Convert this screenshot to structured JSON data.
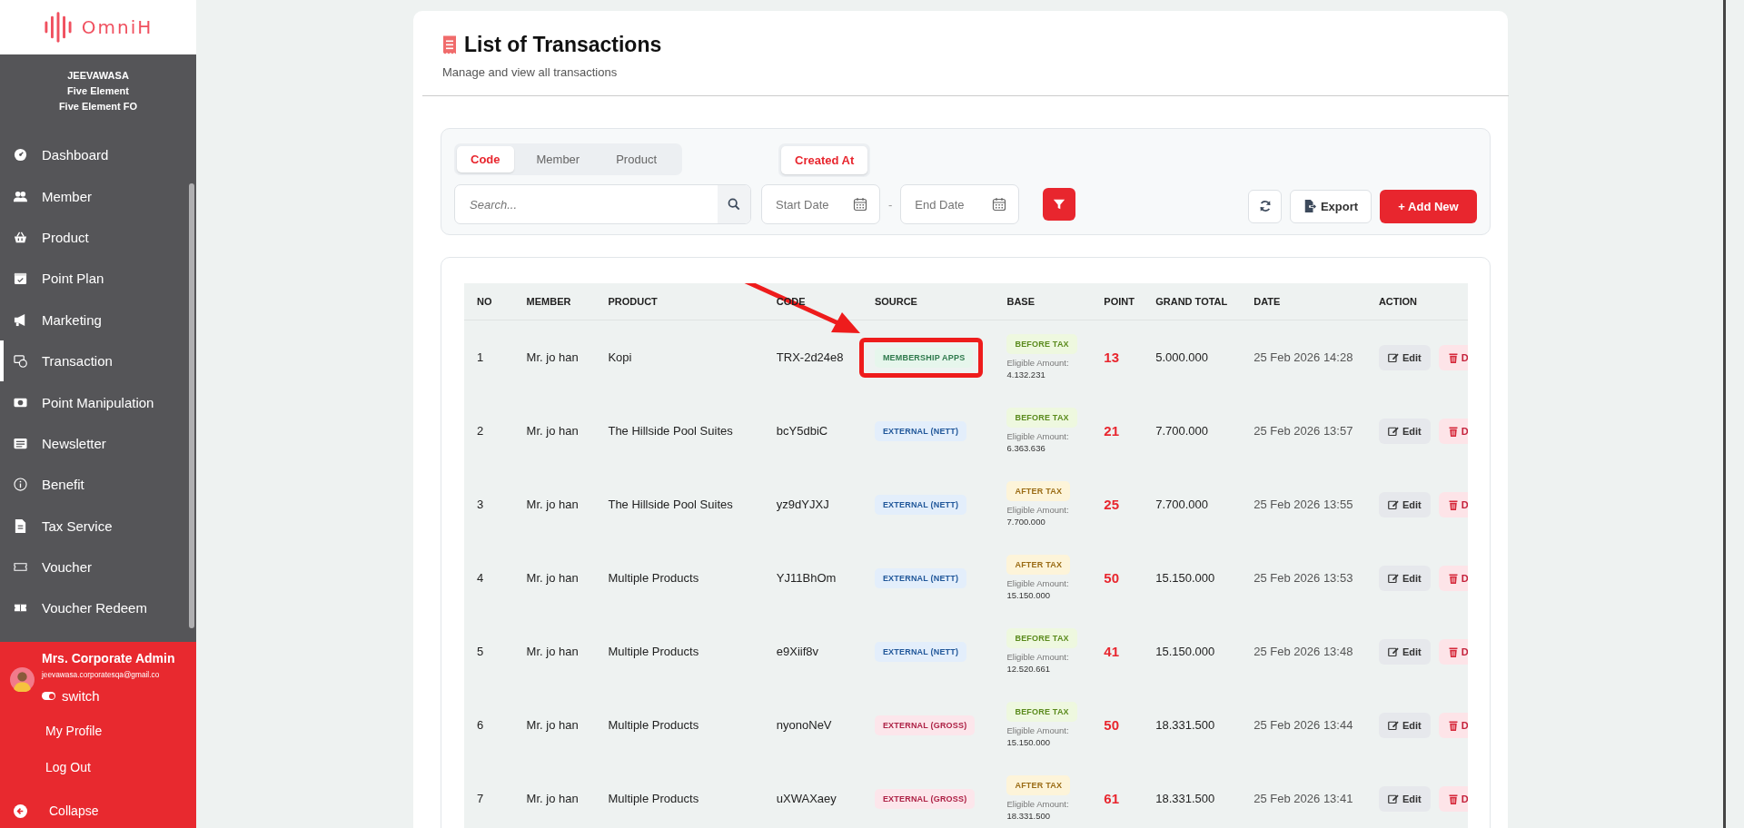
{
  "sidebar": {
    "logo": "OmniH",
    "org": [
      "JEEVAWASA",
      "Five Element",
      "Five Element FO"
    ],
    "items": [
      {
        "label": "Dashboard",
        "selected": false
      },
      {
        "label": "Member",
        "selected": false
      },
      {
        "label": "Product",
        "selected": false
      },
      {
        "label": "Point Plan",
        "selected": false
      },
      {
        "label": "Marketing",
        "selected": false
      },
      {
        "label": "Transaction",
        "selected": true
      },
      {
        "label": "Point Manipulation",
        "selected": false
      },
      {
        "label": "Newsletter",
        "selected": false
      },
      {
        "label": "Benefit",
        "selected": false
      },
      {
        "label": "Tax Service",
        "selected": false
      },
      {
        "label": "Voucher",
        "selected": false
      },
      {
        "label": "Voucher Redeem",
        "selected": false
      }
    ],
    "user": {
      "name": "Mrs. Corporate Admin",
      "email": "jeevawasa.corporatesqa@gmail.co",
      "switch": {
        "label": "switch",
        "on": true
      }
    },
    "links": [
      "My Profile",
      "Log Out"
    ],
    "collapse": "Collapse"
  },
  "header": {
    "title": "List of Transactions",
    "subtitle": "Manage and view all transactions"
  },
  "filters": {
    "search_tabs": [
      {
        "label": "Code",
        "selected": true
      },
      {
        "label": "Member",
        "selected": false
      },
      {
        "label": "Product",
        "selected": false
      }
    ],
    "date_tab": {
      "label": "Created At",
      "selected": true
    },
    "search": {
      "placeholder": "Search..."
    },
    "start_date": {
      "placeholder": "Start Date"
    },
    "separator": "-",
    "end_date": {
      "placeholder": "End Date"
    },
    "export": "Export",
    "add_new": "+ Add New"
  },
  "table": {
    "columns": [
      "NO",
      "MEMBER",
      "PRODUCT",
      "CODE",
      "SOURCE",
      "BASE",
      "POINT",
      "GRAND TOTAL",
      "DATE",
      "ACTION"
    ],
    "rows": [
      {
        "no": "1",
        "member": "Mr. jo han",
        "product": "Kopi",
        "code": "TRX-2d24e8",
        "source": {
          "label": "MEMBERSHIP APPS",
          "kind": "apps",
          "highlighted": true
        },
        "base": {
          "label": "BEFORE TAX",
          "kind": "before"
        },
        "eligible_label": "Eligible Amount:",
        "eligible": "4.132.231",
        "point": "13",
        "grand_total": "5.000.000",
        "date": "25 Feb 2026 14:28",
        "edit": "Edit",
        "delete": "D"
      },
      {
        "no": "2",
        "member": "Mr. jo han",
        "product": "The Hillside Pool Suites",
        "code": "bcY5dbiC",
        "source": {
          "label": "EXTERNAL (NETT)",
          "kind": "nett"
        },
        "base": {
          "label": "BEFORE TAX",
          "kind": "before"
        },
        "eligible_label": "Eligible Amount:",
        "eligible": "6.363.636",
        "point": "21",
        "grand_total": "7.700.000",
        "date": "25 Feb 2026 13:57",
        "edit": "Edit",
        "delete": "D"
      },
      {
        "no": "3",
        "member": "Mr. jo han",
        "product": "The Hillside Pool Suites",
        "code": "yz9dYJXJ",
        "source": {
          "label": "EXTERNAL (NETT)",
          "kind": "nett"
        },
        "base": {
          "label": "AFTER TAX",
          "kind": "after"
        },
        "eligible_label": "Eligible Amount:",
        "eligible": "7.700.000",
        "point": "25",
        "grand_total": "7.700.000",
        "date": "25 Feb 2026 13:55",
        "edit": "Edit",
        "delete": "D"
      },
      {
        "no": "4",
        "member": "Mr. jo han",
        "product": "Multiple Products",
        "code": "YJ11BhOm",
        "source": {
          "label": "EXTERNAL (NETT)",
          "kind": "nett"
        },
        "base": {
          "label": "AFTER TAX",
          "kind": "after"
        },
        "eligible_label": "Eligible Amount:",
        "eligible": "15.150.000",
        "point": "50",
        "grand_total": "15.150.000",
        "date": "25 Feb 2026 13:53",
        "edit": "Edit",
        "delete": "D"
      },
      {
        "no": "5",
        "member": "Mr. jo han",
        "product": "Multiple Products",
        "code": "e9Xiif8v",
        "source": {
          "label": "EXTERNAL (NETT)",
          "kind": "nett"
        },
        "base": {
          "label": "BEFORE TAX",
          "kind": "before"
        },
        "eligible_label": "Eligible Amount:",
        "eligible": "12.520.661",
        "point": "41",
        "grand_total": "15.150.000",
        "date": "25 Feb 2026 13:48",
        "edit": "Edit",
        "delete": "D"
      },
      {
        "no": "6",
        "member": "Mr. jo han",
        "product": "Multiple Products",
        "code": "nyonoNeV",
        "source": {
          "label": "EXTERNAL (GROSS)",
          "kind": "gross"
        },
        "base": {
          "label": "BEFORE TAX",
          "kind": "before"
        },
        "eligible_label": "Eligible Amount:",
        "eligible": "15.150.000",
        "point": "50",
        "grand_total": "18.331.500",
        "date": "25 Feb 2026 13:44",
        "edit": "Edit",
        "delete": "D"
      },
      {
        "no": "7",
        "member": "Mr. jo han",
        "product": "Multiple Products",
        "code": "uXWAXaey",
        "source": {
          "label": "EXTERNAL (GROSS)",
          "kind": "gross"
        },
        "base": {
          "label": "AFTER TAX",
          "kind": "after"
        },
        "eligible_label": "Eligible Amount:",
        "eligible": "18.331.500",
        "point": "61",
        "grand_total": "18.331.500",
        "date": "25 Feb 2026 13:41",
        "edit": "Edit",
        "delete": "D"
      }
    ]
  }
}
